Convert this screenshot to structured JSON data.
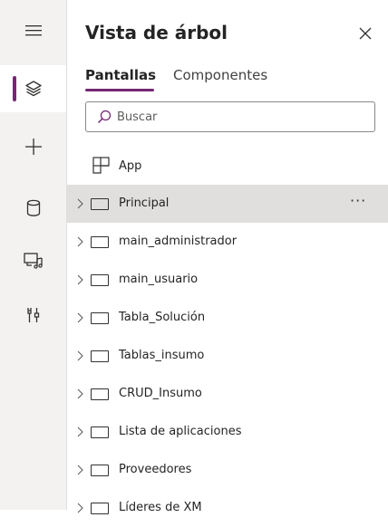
{
  "rail": {
    "items": [
      {
        "icon": "hamburger-menu-icon"
      },
      {
        "icon": "layers-icon",
        "active": true
      },
      {
        "icon": "plus-icon"
      },
      {
        "icon": "database-icon"
      },
      {
        "icon": "media-icon"
      },
      {
        "icon": "tools-icon"
      }
    ],
    "accent": "#742774"
  },
  "panel": {
    "title": "Vista de árbol",
    "tabs": [
      {
        "label": "Pantallas",
        "active": true
      },
      {
        "label": "Componentes",
        "active": false
      }
    ],
    "search": {
      "placeholder": "Buscar"
    },
    "app": {
      "label": "App",
      "icon": "app-tree-icon"
    },
    "screens": [
      {
        "label": "Principal",
        "selected": true,
        "more": "···"
      },
      {
        "label": "main_administrador"
      },
      {
        "label": "main_usuario"
      },
      {
        "label": "Tabla_Solución"
      },
      {
        "label": "Tablas_insumo"
      },
      {
        "label": "CRUD_Insumo"
      },
      {
        "label": "Lista de aplicaciones"
      },
      {
        "label": "Proveedores"
      },
      {
        "label": "Líderes de XM"
      }
    ]
  }
}
